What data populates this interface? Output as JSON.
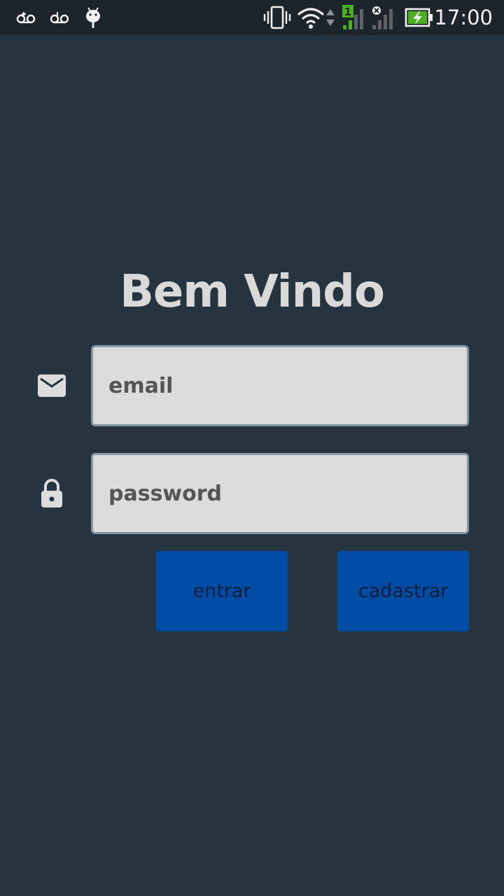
{
  "status_bar": {
    "time": "17:00",
    "sim_number": "1",
    "icons": [
      "voicemail-icon",
      "voicemail-icon",
      "android-debug-icon",
      "vibrate-icon",
      "wifi-icon",
      "data-arrows-icon",
      "signal-sim1-icon",
      "signal-sim2-no-service-icon",
      "battery-charging-icon"
    ],
    "battery_color": "#4caf1e"
  },
  "main": {
    "title": "Bem Vindo",
    "email_field": {
      "placeholder": "email",
      "value": "",
      "icon": "email-icon"
    },
    "password_field": {
      "placeholder": "password",
      "value": "",
      "icon": "lock-icon"
    },
    "login_button_label": "entrar",
    "register_button_label": "cadastrar"
  },
  "colors": {
    "background": "#25343e",
    "button": "#004ba4",
    "input_background": "#dcdcdc"
  }
}
